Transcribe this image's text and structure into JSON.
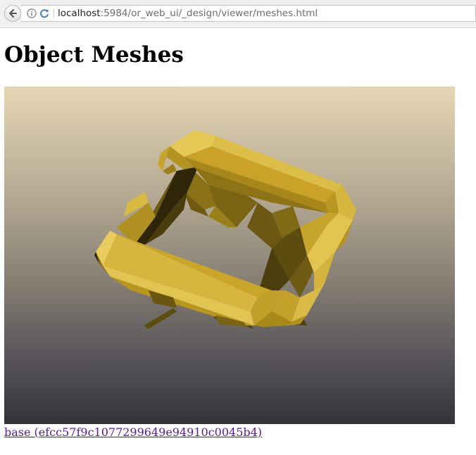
{
  "browser": {
    "url_host": "localhost",
    "url_rest": ":5984/or_web_ui/_design/viewer/meshes.html"
  },
  "page": {
    "title": "Object Meshes"
  },
  "meshes": [
    {
      "link_text": "base (efcc57f9c1077299649e94910c0045b4)"
    }
  ],
  "colors": {
    "visited_link": "#551a8b",
    "mesh_gold": "#c9a227"
  }
}
